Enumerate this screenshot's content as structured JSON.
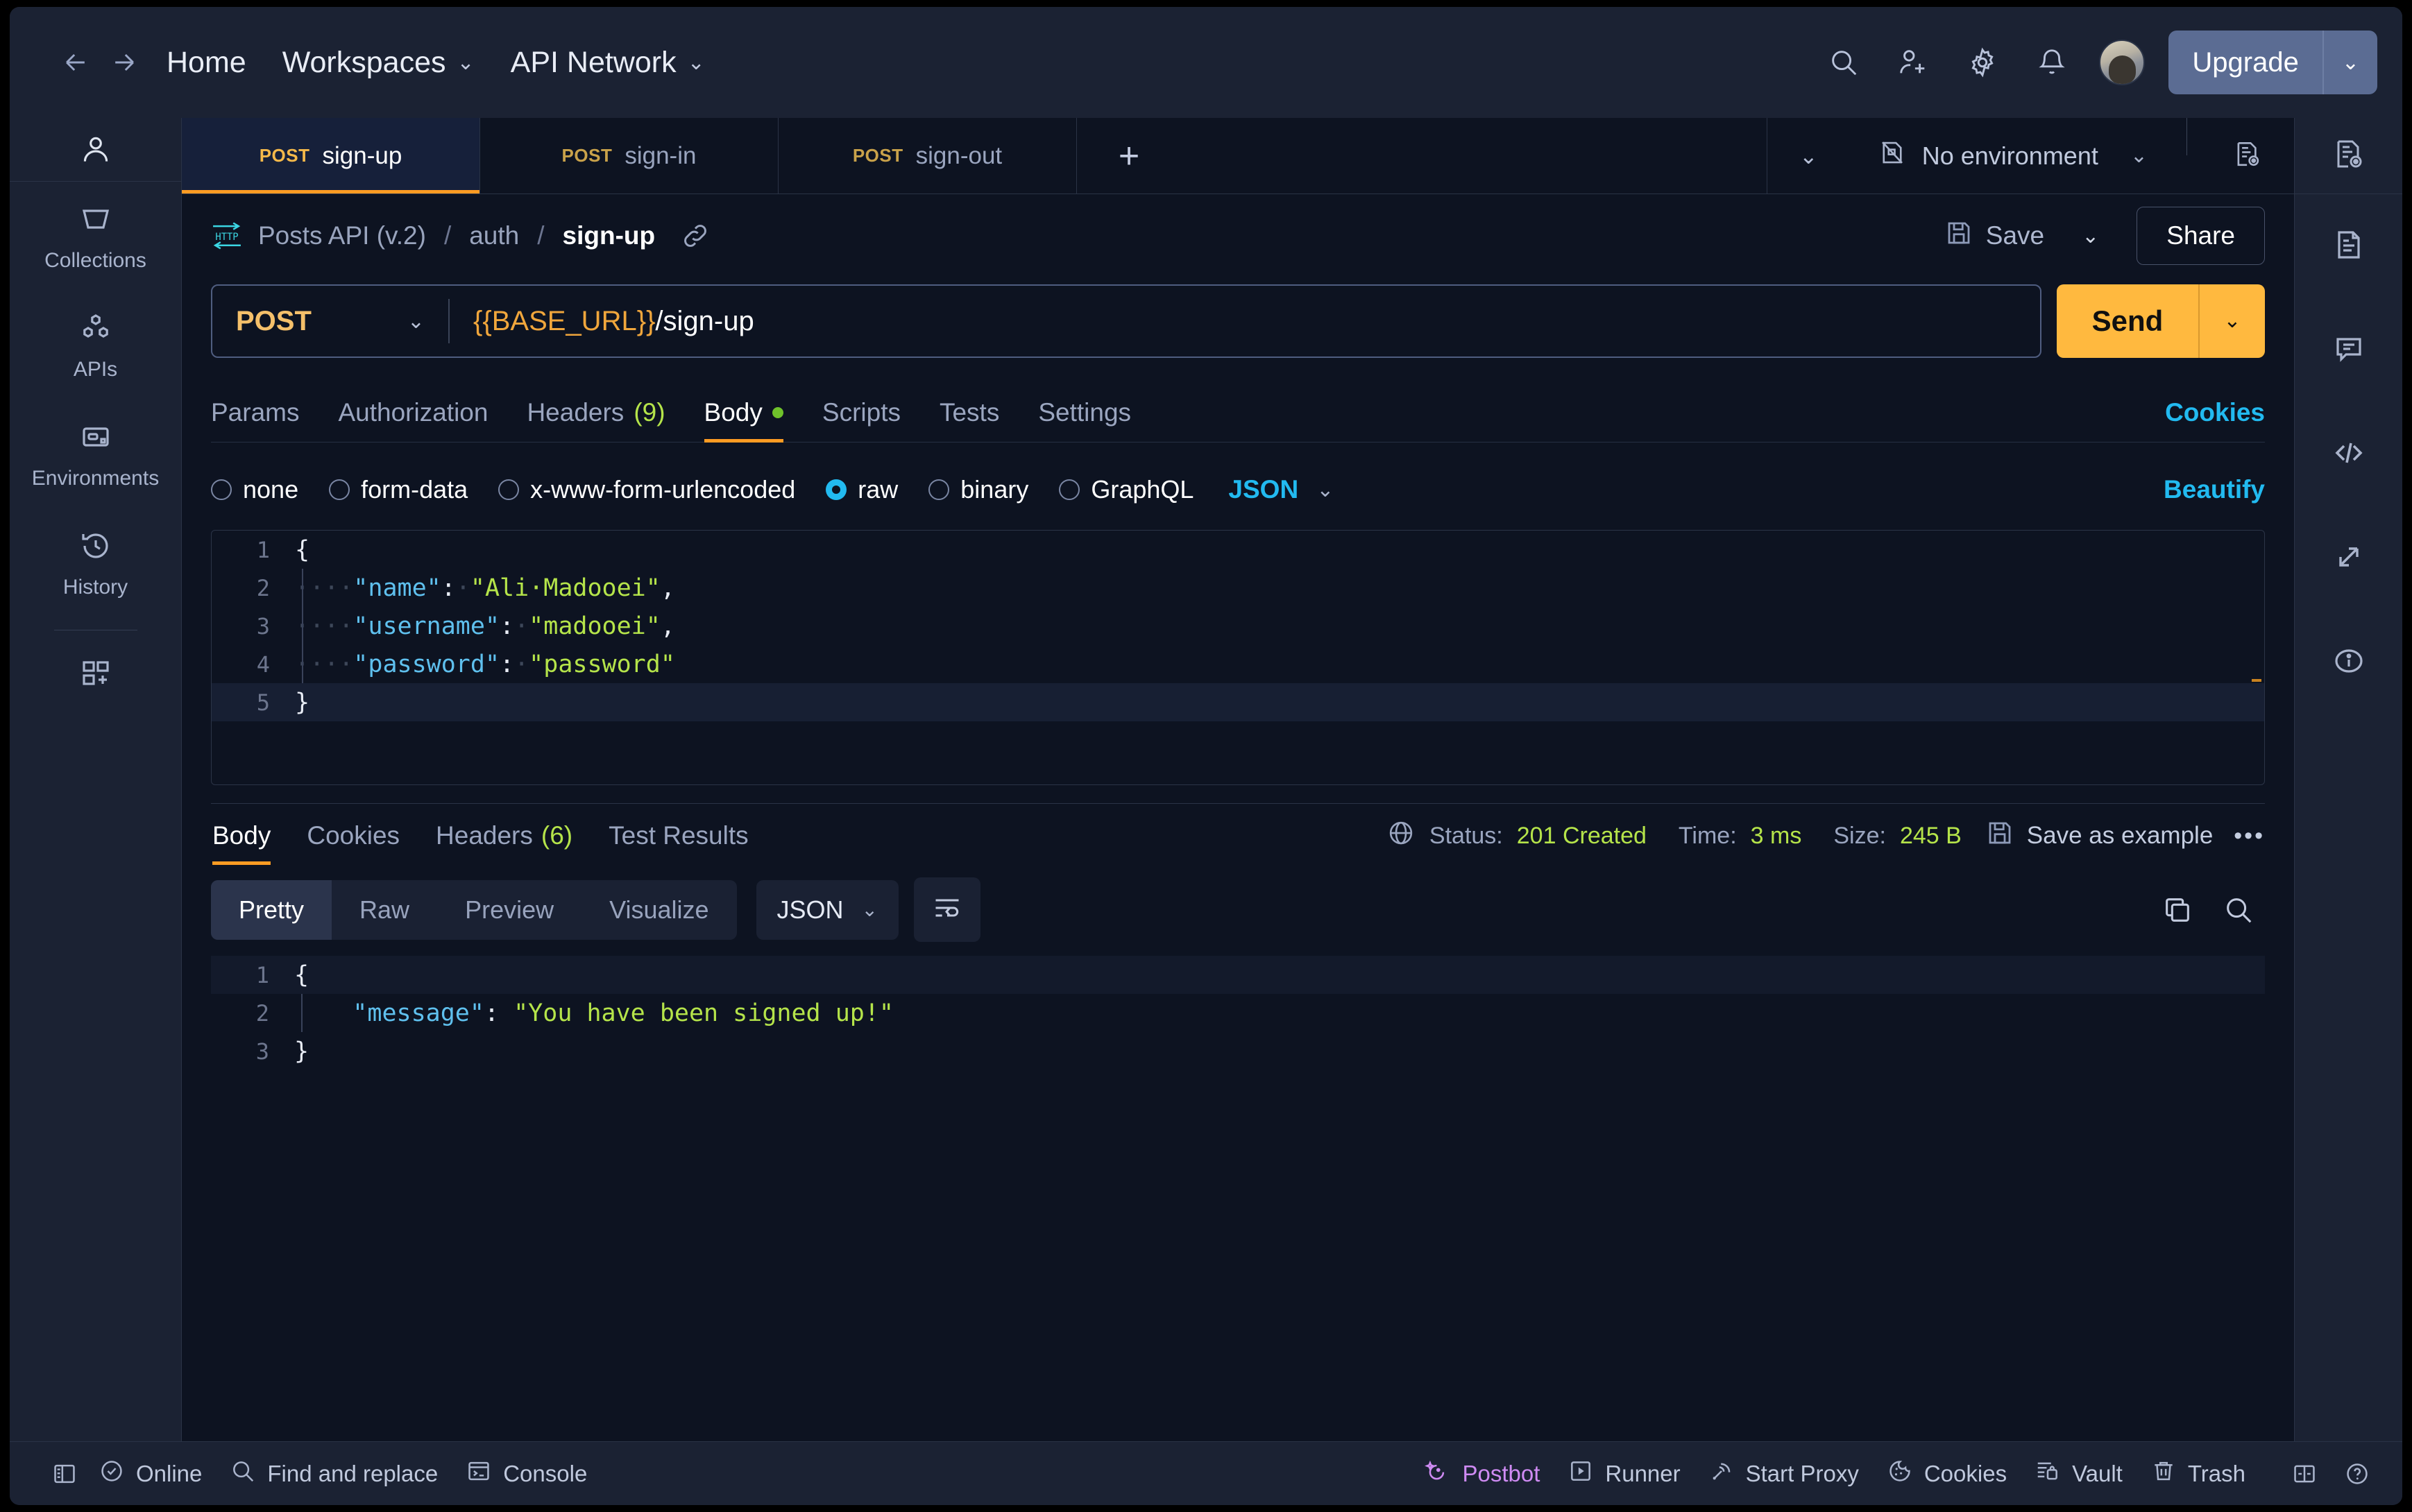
{
  "header": {
    "back_icon": "arrow-left-icon",
    "forward_icon": "arrow-right-icon",
    "home": "Home",
    "workspaces": "Workspaces",
    "api_network": "API Network",
    "caret": "⌄",
    "search_icon": "search-icon",
    "invite_icon": "invite-user-icon",
    "settings_icon": "gear-icon",
    "notifications_icon": "bell-icon",
    "avatar": "avatar",
    "upgrade": "Upgrade"
  },
  "left_rail": {
    "user_icon": "user-icon",
    "items": [
      {
        "label": "Collections",
        "icon": "collections-icon"
      },
      {
        "label": "APIs",
        "icon": "apis-icon"
      },
      {
        "label": "Environments",
        "icon": "environments-icon"
      },
      {
        "label": "History",
        "icon": "history-icon"
      }
    ],
    "new_icon": "new-module-icon"
  },
  "tabs": {
    "items": [
      {
        "method": "POST",
        "name": "sign-up",
        "active": true
      },
      {
        "method": "POST",
        "name": "sign-in",
        "active": false
      },
      {
        "method": "POST",
        "name": "sign-out",
        "active": false
      }
    ],
    "add_label": "+",
    "list_caret": "⌄",
    "environment": "No environment",
    "env_caret": "⌄",
    "env_icon": "no-environment-icon",
    "eye_icon": "environment-quick-look-icon"
  },
  "request": {
    "protocol_icon": "http-icon",
    "breadcrumb": [
      "Posts API (v.2)",
      "auth",
      "sign-up"
    ],
    "breadcrumb_separator": "/",
    "link_icon": "link-icon",
    "save_label": "Save",
    "save_icon": "save-icon",
    "save_caret": "⌄",
    "share_label": "Share",
    "method": "POST",
    "method_caret": "⌄",
    "url_variable": "{{BASE_URL}}",
    "url_path": "/sign-up",
    "send_label": "Send",
    "send_caret": "⌄",
    "tabs": [
      {
        "label": "Params",
        "active": false
      },
      {
        "label": "Authorization",
        "active": false
      },
      {
        "label": "Headers",
        "count": "(9)",
        "active": false
      },
      {
        "label": "Body",
        "active": true,
        "dot": true
      },
      {
        "label": "Scripts",
        "active": false
      },
      {
        "label": "Tests",
        "active": false
      },
      {
        "label": "Settings",
        "active": false
      }
    ],
    "cookies_link": "Cookies",
    "body_types": [
      {
        "label": "none",
        "selected": false
      },
      {
        "label": "form-data",
        "selected": false
      },
      {
        "label": "x-www-form-urlencoded",
        "selected": false
      },
      {
        "label": "raw",
        "selected": true
      },
      {
        "label": "binary",
        "selected": false
      },
      {
        "label": "GraphQL",
        "selected": false
      }
    ],
    "raw_format": "JSON",
    "raw_format_caret": "⌄",
    "beautify_link": "Beautify",
    "body_lines": [
      {
        "n": "1",
        "segments": [
          {
            "t": "{",
            "c": "p"
          }
        ]
      },
      {
        "n": "2",
        "segments": [
          {
            "t": "····",
            "c": "ws"
          },
          {
            "t": "\"name\"",
            "c": "k"
          },
          {
            "t": ":",
            "c": "p"
          },
          {
            "t": "·",
            "c": "ws"
          },
          {
            "t": "\"Ali·Madooei\"",
            "c": "s"
          },
          {
            "t": ",",
            "c": "p"
          }
        ]
      },
      {
        "n": "3",
        "segments": [
          {
            "t": "····",
            "c": "ws"
          },
          {
            "t": "\"username\"",
            "c": "k"
          },
          {
            "t": ":",
            "c": "p"
          },
          {
            "t": "·",
            "c": "ws"
          },
          {
            "t": "\"madooei\"",
            "c": "s"
          },
          {
            "t": ",",
            "c": "p"
          }
        ]
      },
      {
        "n": "4",
        "segments": [
          {
            "t": "····",
            "c": "ws"
          },
          {
            "t": "\"password\"",
            "c": "k"
          },
          {
            "t": ":",
            "c": "p"
          },
          {
            "t": "·",
            "c": "ws"
          },
          {
            "t": "\"password\"",
            "c": "s"
          }
        ]
      },
      {
        "n": "5",
        "segments": [
          {
            "t": "}",
            "c": "p"
          }
        ],
        "highlight": true
      }
    ]
  },
  "response": {
    "tabs": [
      {
        "label": "Body",
        "active": true
      },
      {
        "label": "Cookies",
        "active": false
      },
      {
        "label": "Headers",
        "count": "(6)",
        "active": false
      },
      {
        "label": "Test Results",
        "active": false
      }
    ],
    "globe_icon": "globe-icon",
    "status_label": "Status:",
    "status_value": "201 Created",
    "time_label": "Time:",
    "time_value": "3 ms",
    "size_label": "Size:",
    "size_value": "245 B",
    "save_example_label": "Save as example",
    "save_example_icon": "save-icon",
    "more_icon": "more-options-icon",
    "views": [
      {
        "label": "Pretty",
        "active": true
      },
      {
        "label": "Raw",
        "active": false
      },
      {
        "label": "Preview",
        "active": false
      },
      {
        "label": "Visualize",
        "active": false
      }
    ],
    "format": "JSON",
    "format_caret": "⌄",
    "wrap_icon": "wrap-lines-icon",
    "copy_icon": "copy-icon",
    "search_icon": "search-icon",
    "body_lines": [
      {
        "n": "1",
        "segments": [
          {
            "t": "{",
            "c": "p"
          }
        ],
        "highlight": true
      },
      {
        "n": "2",
        "segments": [
          {
            "t": "    ",
            "c": "p"
          },
          {
            "t": "\"message\"",
            "c": "k"
          },
          {
            "t": ": ",
            "c": "p"
          },
          {
            "t": "\"You have been signed up!\"",
            "c": "s"
          }
        ]
      },
      {
        "n": "3",
        "segments": [
          {
            "t": "}",
            "c": "p"
          }
        ]
      }
    ]
  },
  "right_rail": {
    "items": [
      {
        "icon": "documentation-icon"
      },
      {
        "icon": "comments-icon"
      },
      {
        "icon": "code-snippet-icon"
      },
      {
        "icon": "request-flow-icon"
      },
      {
        "icon": "info-icon"
      }
    ]
  },
  "footer": {
    "sidebar_toggle_icon": "sidebar-toggle-icon",
    "online": "Online",
    "online_icon": "check-circle-icon",
    "find_replace": "Find and replace",
    "find_icon": "search-icon",
    "console": "Console",
    "console_icon": "console-icon",
    "postbot": "Postbot",
    "postbot_icon": "postbot-icon",
    "runner": "Runner",
    "runner_icon": "runner-icon",
    "start_proxy": "Start Proxy",
    "proxy_icon": "proxy-icon",
    "cookies": "Cookies",
    "cookies_icon": "cookie-icon",
    "vault": "Vault",
    "vault_icon": "vault-icon",
    "trash": "Trash",
    "trash_icon": "trash-icon",
    "layout_icon": "two-pane-layout-icon",
    "help_icon": "help-icon"
  },
  "colors": {
    "accent_orange": "#ff9c23",
    "send_amber": "#ffb93f",
    "cyan": "#22baf0",
    "green": "#b5e44a",
    "postbot_purple": "#cf8bf3"
  }
}
